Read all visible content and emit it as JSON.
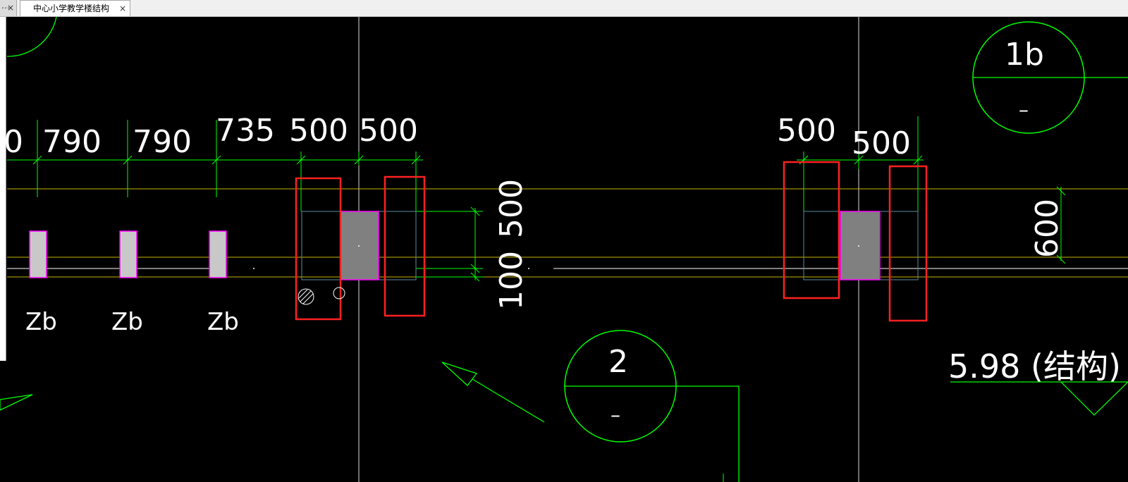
{
  "tabs": {
    "prev_close": "×",
    "active_title": "中心小学教学楼结构",
    "active_close": "×"
  },
  "drawing": {
    "top_dims": [
      "0",
      "790",
      "790",
      "735",
      "500",
      "500"
    ],
    "right_top_dims": [
      "500",
      "500"
    ],
    "vertical_dims": [
      "500",
      "100",
      "600"
    ],
    "column_labels": [
      "Zb",
      "Zb",
      "Zb"
    ],
    "callout_1": {
      "top": "1b",
      "bottom": "–"
    },
    "callout_2": {
      "top": "2",
      "bottom": "–"
    },
    "elevation": "5.98 (结构)"
  },
  "colors": {
    "background": "#000000",
    "line_green": "#00ff00",
    "highlight_red": "#ff0000",
    "column_fill": "#c8c8c8",
    "column_border": "#ff00ff",
    "beam_yellow": "#c8b400"
  }
}
